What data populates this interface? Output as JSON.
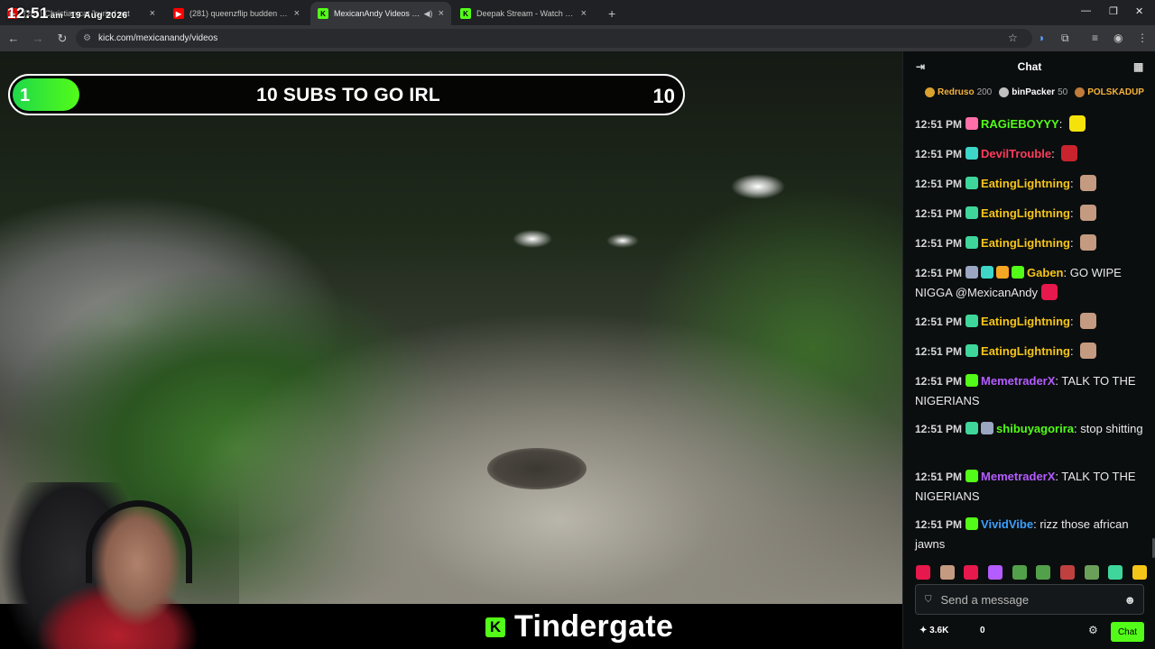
{
  "browser": {
    "tabs": [
      {
        "title": "(281) Christian cat 'buried out",
        "fav_color": "#ff0000",
        "fav_glyph": "▶",
        "active": false
      },
      {
        "title": "(281) queenzflip budden - YouTube",
        "fav_color": "#ff0000",
        "fav_glyph": "▶",
        "active": false
      },
      {
        "title": "MexicanAndy Videos - Watch",
        "fav_color": "#53fc18",
        "fav_glyph": "K",
        "active": true
      },
      {
        "title": "Deepak Stream - Watch Live on Kick",
        "fav_color": "#53fc18",
        "fav_glyph": "K",
        "active": false
      }
    ],
    "url": "kick.com/mexicanandy/videos",
    "clock": {
      "time": "12:51",
      "ampm": "am",
      "date": "19 Aug 2026"
    }
  },
  "video": {
    "goal": {
      "current": "1",
      "title": "10 SUBS TO GO IRL",
      "target": "10",
      "progress_fraction": 0.1
    },
    "caption": "Tindergate"
  },
  "chat": {
    "title": "Chat",
    "leaderboard": [
      {
        "name": "Redruso",
        "count": "200",
        "color": "#f6b23a",
        "badge": "#d9a22e"
      },
      {
        "name": "binPacker",
        "count": "50",
        "color": "#ffffff",
        "badge": "#c0c0c0"
      },
      {
        "name": "POLSKADUP",
        "count": "",
        "color": "#f6b23a",
        "badge": "#c07a3a"
      }
    ],
    "messages": [
      {
        "time": "12:51 PM",
        "user": "RAGiEBOYYY",
        "color": "#53fc18",
        "badges": [
          "#ff6fa8"
        ],
        "text": "",
        "emote": "#f4e20a"
      },
      {
        "time": "12:51 PM",
        "user": "DevilTrouble",
        "color": "#ff3b5c",
        "badges": [
          "#3ed6c8"
        ],
        "text": "",
        "emote": "#c9242e"
      },
      {
        "time": "12:51 PM",
        "user": "EatingLightning",
        "color": "#f5c518",
        "badges": [
          "#3ed69a"
        ],
        "text": "",
        "emote": "#c49a80"
      },
      {
        "time": "12:51 PM",
        "user": "EatingLightning",
        "color": "#f5c518",
        "badges": [
          "#3ed69a"
        ],
        "text": "",
        "emote": "#c49a80"
      },
      {
        "time": "12:51 PM",
        "user": "EatingLightning",
        "color": "#f5c518",
        "badges": [
          "#3ed69a"
        ],
        "text": "",
        "emote": "#c49a80"
      },
      {
        "time": "12:51 PM",
        "user": "Gaben",
        "color": "#f5c518",
        "badges": [
          "#9aa6c2",
          "#3ed6c8",
          "#f5a623",
          "#53fc18"
        ],
        "text": "GO WIPE NIGGA @MexicanAndy",
        "emote": "#e6184c"
      },
      {
        "time": "12:51 PM",
        "user": "EatingLightning",
        "color": "#f5c518",
        "badges": [
          "#3ed69a"
        ],
        "text": "",
        "emote": "#c49a80"
      },
      {
        "time": "12:51 PM",
        "user": "EatingLightning",
        "color": "#f5c518",
        "badges": [
          "#3ed69a"
        ],
        "text": "",
        "emote": "#c49a80"
      },
      {
        "time": "12:51 PM",
        "user": "MemetraderX",
        "color": "#b45cff",
        "badges": [
          "#53fc18"
        ],
        "text": "TALK TO THE NIGERIANS",
        "emote": ""
      },
      {
        "time": "12:51 PM",
        "user": "shibuyagorira",
        "color": "#53fc18",
        "badges": [
          "#3ed69a",
          "#9aa6c2"
        ],
        "text": "stop shitting",
        "emote": ""
      },
      {
        "time": "12:51 PM",
        "user": "MemetraderX",
        "color": "#b45cff",
        "badges": [
          "#53fc18"
        ],
        "text": "TALK TO THE NIGERIANS",
        "emote": ""
      },
      {
        "time": "12:51 PM",
        "user": "VividVibe",
        "color": "#3aa0ff",
        "badges": [
          "#53fc18"
        ],
        "text": "rizz those african jawns",
        "emote": ""
      }
    ],
    "emote_bar": [
      "#e6184c",
      "#c49a80",
      "#e6184c",
      "#b45cff",
      "#53a04a",
      "#53a04a",
      "#c04040",
      "#6aa05a",
      "#3ed69a",
      "#f5c518"
    ],
    "input_placeholder": "Send a message",
    "points": "3.6K",
    "zero": "0",
    "send_label": "Chat"
  }
}
